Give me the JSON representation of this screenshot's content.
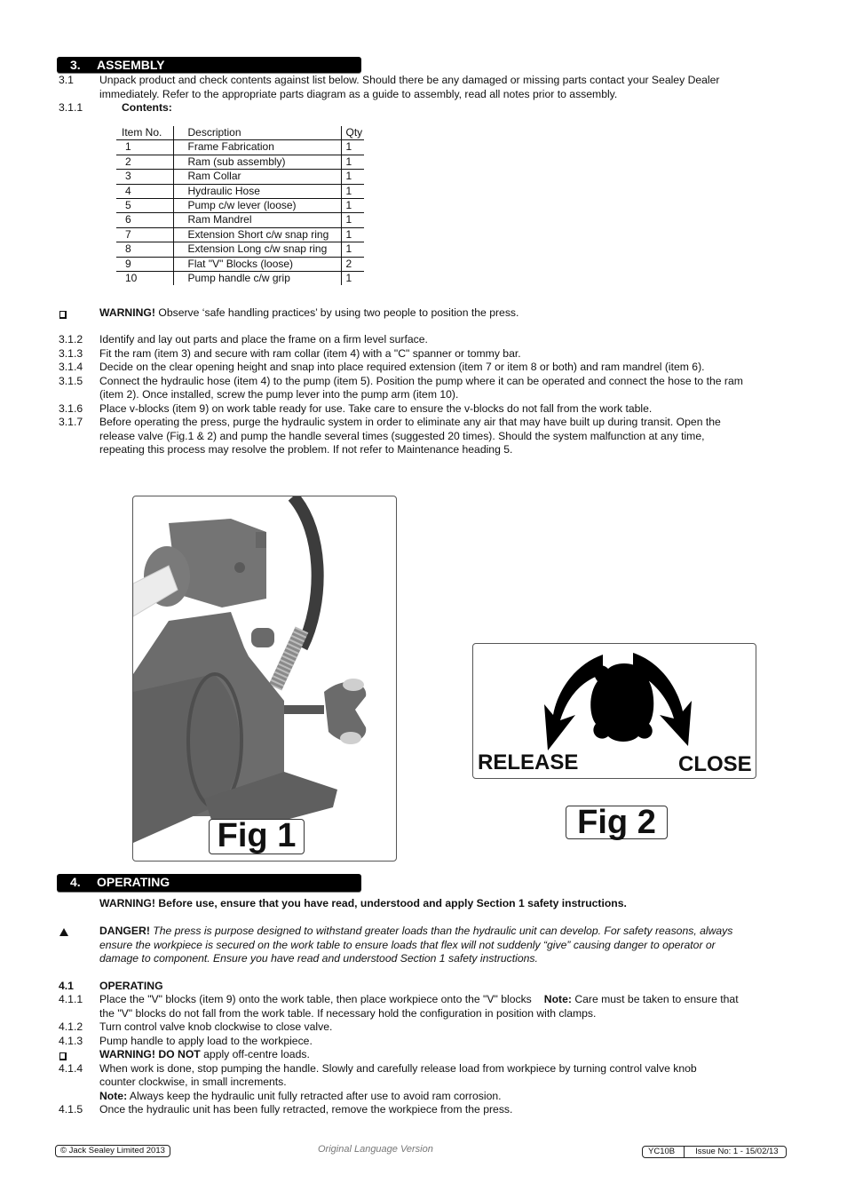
{
  "section3": {
    "number": "3.",
    "title": "ASSEMBLY",
    "items": [
      {
        "num": "3.1",
        "text_lines": [
          "Unpack product and check contents against list below. Should there be any damaged or missing parts contact your Sealey Dealer",
          "immediately. Refer to the appropriate parts diagram as a guide to assembly, read all notes prior to assembly."
        ]
      },
      {
        "num": "3.1.1",
        "text": "Contents:"
      }
    ],
    "contents_table": {
      "headers": [
        "Item No.",
        "Description",
        "Qty"
      ],
      "rows": [
        [
          "1",
          "Frame Fabrication",
          "1"
        ],
        [
          "2",
          "Ram (sub assembly)",
          "1"
        ],
        [
          "3",
          "Ram Collar",
          "1"
        ],
        [
          "4",
          "Hydraulic Hose",
          "1"
        ],
        [
          "5",
          "Pump c/w lever (loose)",
          "1"
        ],
        [
          "6",
          "Ram Mandrel",
          "1"
        ],
        [
          "7",
          "Extension Short c/w snap ring",
          "1"
        ],
        [
          "8",
          "Extension Long c/w snap ring",
          "1"
        ],
        [
          "9",
          "Flat \"V\" Blocks (loose)",
          "2"
        ],
        [
          "10",
          "Pump handle c/w grip",
          "1"
        ]
      ]
    },
    "warning": {
      "icon": "checkbox-icon",
      "label": "WARNING!",
      "text": " Observe ‘safe handling practices’ by using two people to position the press."
    },
    "steps": [
      {
        "num": "3.1.2",
        "lines": [
          "Identify and lay out parts and place the frame on a firm level surface."
        ]
      },
      {
        "num": "3.1.3",
        "lines": [
          "Fit the ram (item 3) and secure with ram collar (item 4) with a \"C\" spanner or tommy bar."
        ]
      },
      {
        "num": "3.1.4",
        "lines": [
          "Decide on the clear opening height and snap into place required extension (item 7 or item 8 or both) and ram mandrel (item 6)."
        ]
      },
      {
        "num": "3.1.5",
        "lines": [
          "Connect the hydraulic hose (item 4) to the pump (item 5). Position the pump where it can be operated and connect the hose to the ram",
          "(item 2). Once installed, screw the pump lever into the pump arm (item 10)."
        ]
      },
      {
        "num": "3.1.6",
        "lines": [
          "Place v-blocks (item 9) on work table ready for use. Take care to ensure the v-blocks do not fall from the work table."
        ]
      },
      {
        "num": "3.1.7",
        "lines": [
          "Before operating the press, purge the hydraulic system in order to eliminate any air that may have built up during transit. Open the",
          "release valve (Fig.1 & 2) and pump the handle several times (suggested 20 times). Should the system malfunction at any time,",
          "repeating this process may resolve the problem. If not refer to Maintenance heading 5."
        ]
      }
    ]
  },
  "figures": {
    "fig1_label": "Fig 1",
    "fig2_label": "Fig 2",
    "fig2_release": "RELEASE",
    "fig2_close": "CLOSE"
  },
  "section4": {
    "number": "4.",
    "title": "OPERATING",
    "warning_line": "WARNING! Before use, ensure that you have read, understood and apply Section 1 safety instructions.",
    "danger": {
      "icon": "triangle-icon",
      "label": "DANGER!",
      "lines": [
        " The press is purpose designed to withstand greater loads than the hydraulic unit can develop. For safety reasons, always",
        "ensure the workpiece is secured on the work table to ensure loads that flex will not suddenly “give” causing danger to operator or",
        "damage to component. Ensure you have read and understood Section 1 safety instructions."
      ]
    },
    "subheading": {
      "num": "4.1",
      "title": "OPERATING"
    },
    "step_411": {
      "num": "4.1.1",
      "line1_a": "Place the \"V\" blocks (item 9) onto the work table, then place workpiece onto the \"V\" blocks",
      "line1_note": "Note:",
      "line1_b": " Care must be taken to ensure that",
      "line2": "the \"V\" blocks do not fall from the work table. If necessary hold the configuration in position with clamps."
    },
    "step_412": {
      "num": "4.1.2",
      "text": "Turn control valve knob clockwise to close valve."
    },
    "step_413": {
      "num": "4.1.3",
      "text": "Pump handle to apply load to the workpiece."
    },
    "warning2": {
      "icon": "checkbox-icon",
      "label": "WARNING! DO NOT",
      "text": " apply off-centre loads."
    },
    "step_414": {
      "num": "4.1.4",
      "lines": [
        "When work is done, stop pumping the handle. Slowly and carefully release load from workpiece by turning control valve knob",
        "counter clockwise, in small increments."
      ],
      "note_label": "Note:",
      "note_text": " Always keep the hydraulic unit fully retracted after use to avoid ram corrosion."
    },
    "step_415": {
      "num": "4.1.5",
      "text": "Once the hydraulic unit has been fully retracted, remove the workpiece from the press."
    }
  },
  "footer": {
    "copyright": "© Jack Sealey Limited 2013",
    "center": "Original Language Version",
    "model": "YC10B",
    "issue": "Issue No: 1 - 15/02/13"
  }
}
